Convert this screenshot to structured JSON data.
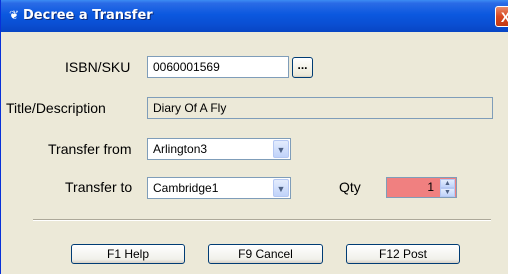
{
  "window": {
    "title": "Decree a Transfer",
    "close_label": "X",
    "icon": "app-icon"
  },
  "form": {
    "isbn_label": "ISBN/SKU",
    "isbn_value": "0060001569",
    "browse_label": "...",
    "title_label": "Title/Description",
    "title_value": "Diary Of A Fly",
    "from_label": "Transfer from",
    "from_value": "Arlington3",
    "to_label": "Transfer to",
    "to_value": "Cambridge1",
    "qty_label": "Qty",
    "qty_value": "1"
  },
  "buttons": {
    "help": "F1 Help",
    "cancel": "F9 Cancel",
    "post": "F12 Post"
  },
  "colors": {
    "qty_bg": "#f08080",
    "title_bar": "#0a4fd3"
  }
}
